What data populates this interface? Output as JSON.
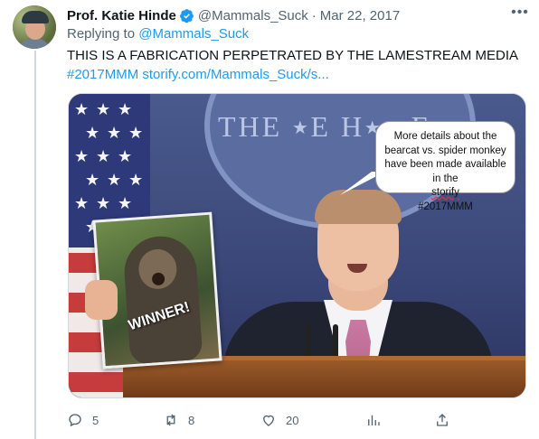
{
  "tweet": {
    "author_name": "Prof. Katie Hinde",
    "author_handle": "@Mammals_Suck",
    "separator": "·",
    "date": "Mar 22, 2017",
    "more_icon": "more-icon",
    "reply_prefix": "Replying to",
    "reply_to": "@Mammals_Suck",
    "text_line1": "THIS IS A FABRICATION PERPETRATED BY THE LAMESTREAM MEDIA",
    "hashtag": "#2017MMM",
    "url": "storify.com/Mammals_Suck/s..."
  },
  "media": {
    "seal_text": "THE ⭑E H⭑ ⭑E",
    "photo_caption": "WINNER!",
    "bubble_line1": "More details about the",
    "bubble_line2": "bearcat vs. spider monkey",
    "bubble_line3": "have been made available",
    "bubble_line4_prefix": "in the",
    "bubble_line4_link": "storify",
    "bubble_line4_suffix": "#2017MMM"
  },
  "actions": {
    "reply_count": "5",
    "retweet_count": "8",
    "like_count": "20",
    "views_icon": "analytics-icon",
    "share_icon": "share-icon"
  },
  "colors": {
    "link": "#1d9bf0",
    "muted": "#536471",
    "verified": "#1d9bf0"
  }
}
